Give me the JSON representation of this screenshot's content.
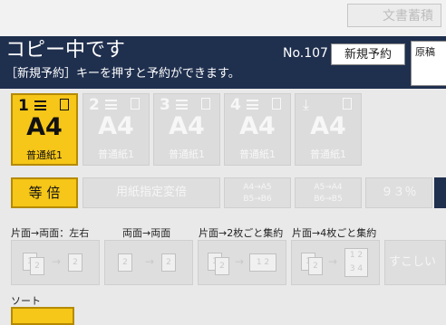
{
  "top": {
    "mode_button": "文書蓄積"
  },
  "status": {
    "title": "コピー中です",
    "subtitle": "［新規予約］キーを押すと予約ができます。",
    "job_no": "No.107",
    "reserve_button": "新規予約",
    "original_button": "原稿"
  },
  "trays": [
    {
      "num": "1",
      "size": "A4",
      "paper": "普通紙1",
      "selected": true
    },
    {
      "num": "2",
      "size": "A4",
      "paper": "普通紙1",
      "selected": false
    },
    {
      "num": "3",
      "size": "A4",
      "paper": "普通紙1",
      "selected": false
    },
    {
      "num": "4",
      "size": "A4",
      "paper": "普通紙1",
      "selected": false
    },
    {
      "num": "⤓",
      "size": "A4",
      "paper": "普通紙1",
      "selected": false
    }
  ],
  "ratio": {
    "full_size": "等 倍",
    "specify_paper": "用紙指定変倍",
    "reduce_a4_a5_line1": "A4→A5",
    "reduce_a4_a5_line2": "B5→B6",
    "enlarge_line1": "A5→A4",
    "enlarge_line2": "B6→B5",
    "percent": "９３％"
  },
  "duplex": {
    "label_1": "片面→両面：左右",
    "label_2": "両面→両面",
    "label_3": "片面→2枚ごと集約",
    "label_4": "片面→4枚ごと集約",
    "more": "すこしい"
  },
  "sort": {
    "label": "ソート"
  }
}
